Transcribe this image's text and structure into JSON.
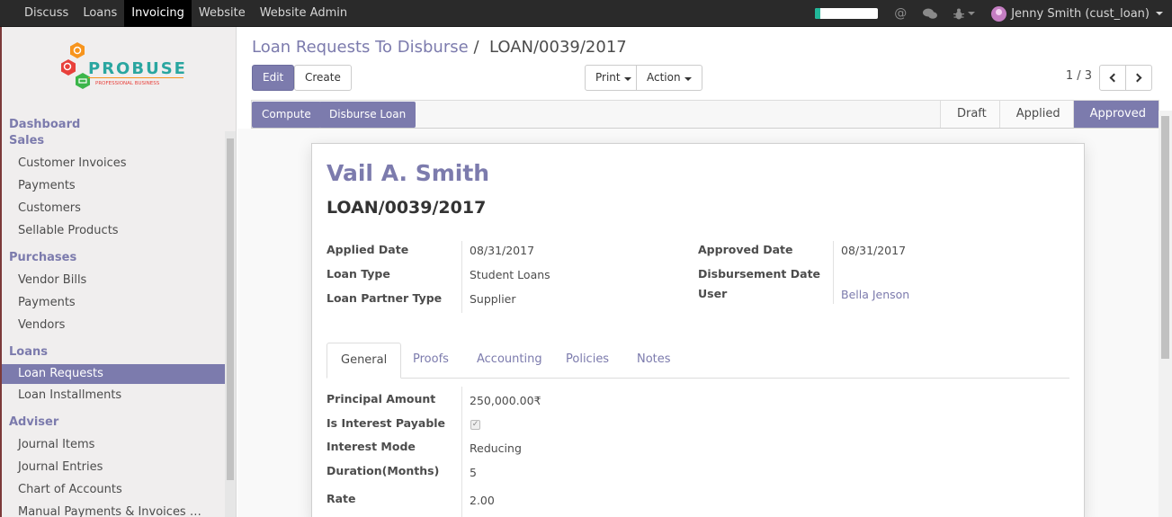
{
  "topbar": {
    "apps": [
      "Discuss",
      "Loans",
      "Invoicing",
      "Website",
      "Website Admin"
    ],
    "active_app": "Invoicing",
    "progress_fraction": 0.08,
    "user_name": "Jenny Smith (cust_loan)",
    "icons": [
      "progress-bar",
      "at-icon",
      "chat-icon",
      "bug-icon"
    ]
  },
  "logo": {
    "name": "PROBUSE",
    "tagline": "PROFESSIONAL BUSINESS"
  },
  "sidebar": {
    "sections": [
      {
        "title": "Dashboard",
        "items": []
      },
      {
        "title": "Sales",
        "items": [
          "Customer Invoices",
          "Payments",
          "Customers",
          "Sellable Products"
        ]
      },
      {
        "title": "Purchases",
        "items": [
          "Vendor Bills",
          "Payments",
          "Vendors"
        ]
      },
      {
        "title": "Loans",
        "items": [
          "Loan Requests",
          "Loan Installments"
        ]
      },
      {
        "title": "Adviser",
        "items": [
          "Journal Items",
          "Journal Entries",
          "Chart of Accounts",
          "Manual Payments & Invoices …"
        ]
      }
    ],
    "active_item": "Loan Requests"
  },
  "breadcrumb": {
    "parent": "Loan Requests To Disburse",
    "separator": "/",
    "current": "LOAN/0039/2017"
  },
  "buttons": {
    "edit": "Edit",
    "create": "Create",
    "print": "Print",
    "action": "Action",
    "compute": "Compute",
    "disburse": "Disburse Loan"
  },
  "pager": {
    "value": "1 / 3"
  },
  "stages": [
    "Draft",
    "Applied",
    "Approved"
  ],
  "active_stage": "Approved",
  "record": {
    "partner_name": "Vail A. Smith",
    "loan_number": "LOAN/0039/2017",
    "left_fields": [
      {
        "label": "Applied Date",
        "value": "08/31/2017"
      },
      {
        "label": "Loan Type",
        "value": "Student Loans"
      },
      {
        "label": "Loan Partner Type",
        "value": "Supplier"
      }
    ],
    "right_fields": [
      {
        "label": "Approved Date",
        "value": "08/31/2017"
      },
      {
        "label": "Disbursement Date",
        "value": ""
      },
      {
        "label": "User",
        "value": "Bella Jenson"
      }
    ]
  },
  "tabs": [
    "General",
    "Proofs",
    "Accounting",
    "Policies",
    "Notes"
  ],
  "active_tab": "General",
  "general": {
    "fields": [
      {
        "label": "Principal Amount",
        "value": "250,000.00₹"
      },
      {
        "label": "Is Interest Payable",
        "value": "",
        "checked": true
      },
      {
        "label": "Interest Mode",
        "value": "Reducing"
      },
      {
        "label": "Duration(Months)",
        "value": "5"
      },
      {
        "label": "Rate",
        "value": "2.00"
      }
    ]
  },
  "colors": {
    "brand": "#7c7bad",
    "topbar": "#2a2a2a",
    "sidebar_bg": "#f0eeee"
  }
}
